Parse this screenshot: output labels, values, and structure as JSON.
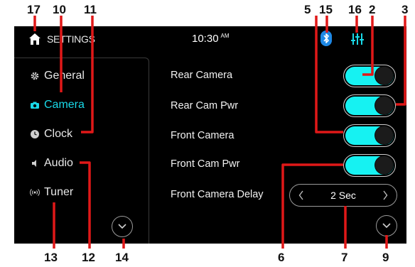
{
  "topbar": {
    "title": "SETTINGS",
    "time": "10:30",
    "ampm": "AM"
  },
  "sidebar": {
    "items": [
      {
        "label": "General",
        "icon": "gear-icon",
        "active": false
      },
      {
        "label": "Camera",
        "icon": "camera-icon",
        "active": true
      },
      {
        "label": "Clock",
        "icon": "clock-icon",
        "active": false
      },
      {
        "label": "Audio",
        "icon": "speaker-icon",
        "active": false
      },
      {
        "label": "Tuner",
        "icon": "antenna-icon",
        "active": false
      }
    ]
  },
  "settings": {
    "rows": [
      {
        "label": "Rear Camera",
        "state": "on"
      },
      {
        "label": "Rear Cam Pwr",
        "state": "on"
      },
      {
        "label": "Front Camera",
        "state": "on"
      },
      {
        "label": "Front Cam Pwr",
        "state": "on"
      }
    ],
    "delay": {
      "label": "Front Camera Delay",
      "value": "2 Sec"
    }
  },
  "callouts": {
    "n17": "17",
    "n10": "10",
    "n11": "11",
    "n5": "5",
    "n15": "15",
    "n16": "16",
    "n2": "2",
    "n3": "3",
    "n13": "13",
    "n12": "12",
    "n14": "14",
    "n6": "6",
    "n7": "7",
    "n9": "9"
  },
  "colors": {
    "accent": "#16f2f2",
    "active_text": "#19d9e8",
    "callout_line": "#e01818",
    "background": "#000000"
  }
}
